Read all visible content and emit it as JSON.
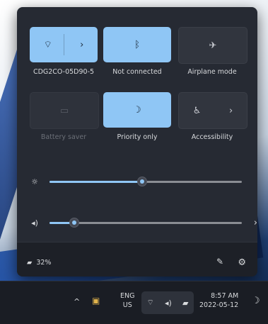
{
  "quick_settings": {
    "tiles": [
      {
        "label": "CDG2CO-05D90-5",
        "icon": "wifi-icon",
        "has_arrow": true,
        "state": "on"
      },
      {
        "label": "Not connected",
        "icon": "bluetooth-icon",
        "has_arrow": false,
        "state": "on"
      },
      {
        "label": "Airplane mode",
        "icon": "airplane-icon",
        "has_arrow": false,
        "state": "off"
      },
      {
        "label": "Battery saver",
        "icon": "battery-saver-icon",
        "has_arrow": false,
        "state": "disabled"
      },
      {
        "label": "Priority only",
        "icon": "focus-assist-icon",
        "has_arrow": false,
        "state": "on"
      },
      {
        "label": "Accessibility",
        "icon": "accessibility-icon",
        "has_arrow": true,
        "state": "off"
      }
    ],
    "brightness": {
      "icon": "brightness-icon",
      "level": 0.48
    },
    "volume": {
      "icon": "volume-icon",
      "level": 0.13
    },
    "battery_percent": "32%",
    "accent_color": "#8fc6f5"
  },
  "taskbar": {
    "language": "ENG",
    "region": "US",
    "time": "8:57 AM",
    "date": "2022-05-12"
  }
}
